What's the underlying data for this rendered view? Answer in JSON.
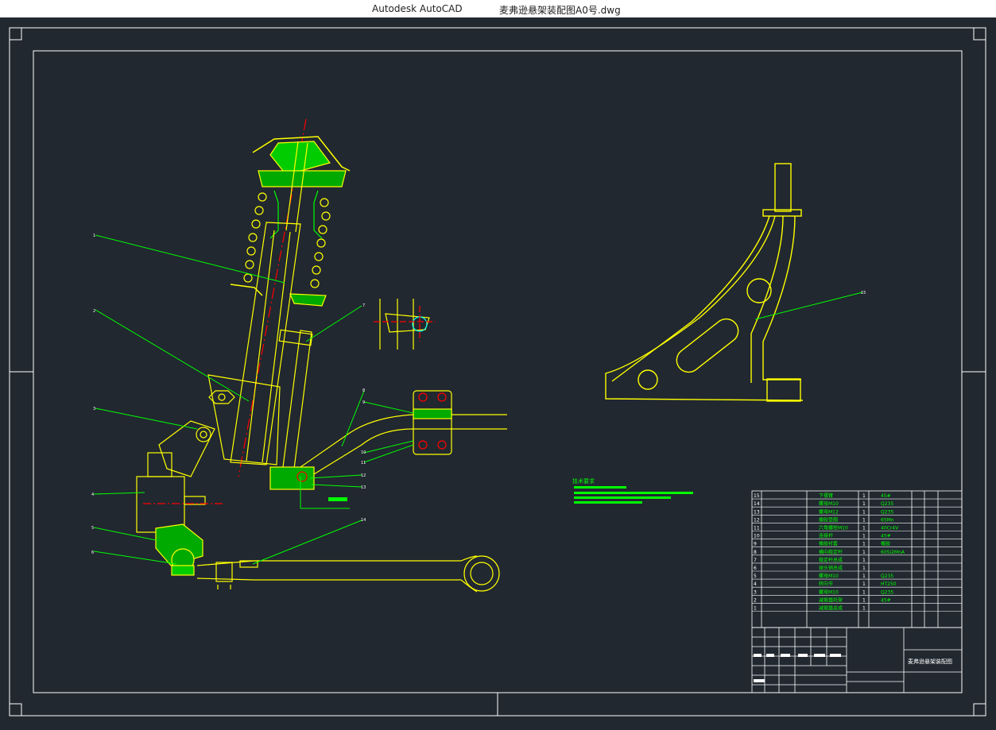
{
  "window": {
    "app_name": "Autodesk AutoCAD",
    "file_name": "麦弗逊悬架装配图A0号.dwg"
  },
  "drawing": {
    "background": "#212830",
    "colors": {
      "line": "#ffff00",
      "leader": "#00ff00",
      "center": "#ff0000",
      "frame": "#ffffff"
    },
    "title_block_name": "麦弗逊悬架装配图",
    "notes_heading": "技术要求",
    "balloons": [
      "1",
      "2",
      "3",
      "4",
      "5",
      "6",
      "7",
      "8",
      "9",
      "10",
      "11",
      "12",
      "13",
      "14",
      "15"
    ],
    "parts_list": {
      "rows": [
        {
          "no": "15",
          "name": "下摆臂",
          "qty": "1",
          "material": "45#"
        },
        {
          "no": "14",
          "name": "螺母M10",
          "qty": "1",
          "material": "Q235"
        },
        {
          "no": "13",
          "name": "螺母M12",
          "qty": "1",
          "material": "Q235"
        },
        {
          "no": "12",
          "name": "橡胶垫圈",
          "qty": "1",
          "material": "65Mn"
        },
        {
          "no": "11",
          "name": "六角螺栓M10",
          "qty": "1",
          "material": "40Cr4V"
        },
        {
          "no": "10",
          "name": "连接杆",
          "qty": "1",
          "material": "45#"
        },
        {
          "no": "9",
          "name": "橡胶衬套",
          "qty": "1",
          "material": "橡胶"
        },
        {
          "no": "8",
          "name": "横向稳定杆",
          "qty": "1",
          "material": "60Si2MnA"
        },
        {
          "no": "7",
          "name": "稳定杆总成",
          "qty": "1",
          "material": ""
        },
        {
          "no": "6",
          "name": "球头销总成",
          "qty": "1",
          "material": ""
        },
        {
          "no": "5",
          "name": "螺母M10",
          "qty": "1",
          "material": "Q235"
        },
        {
          "no": "4",
          "name": "转向节",
          "qty": "1",
          "material": "HT250"
        },
        {
          "no": "3",
          "name": "螺母M10",
          "qty": "1",
          "material": "Q235"
        },
        {
          "no": "2",
          "name": "减振器托架",
          "qty": "1",
          "material": "45#"
        },
        {
          "no": "1",
          "name": "减振器总成",
          "qty": "1",
          "material": ""
        }
      ]
    }
  }
}
